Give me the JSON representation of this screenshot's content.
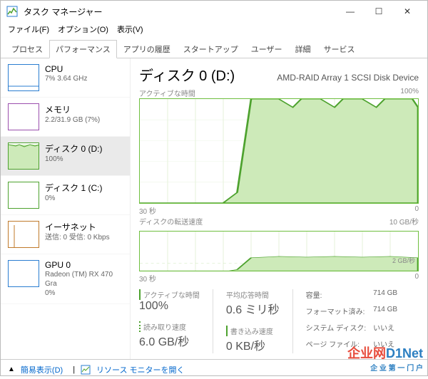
{
  "title": "タスク マネージャー",
  "menus": [
    "ファイル(F)",
    "オプション(O)",
    "表示(V)"
  ],
  "tabs": [
    "プロセス",
    "パフォーマンス",
    "アプリの履歴",
    "スタートアップ",
    "ユーザー",
    "詳細",
    "サービス"
  ],
  "active_tab": 1,
  "sidebar": [
    {
      "name": "CPU",
      "sub": "7%  3.64 GHz",
      "color": "#2a7dd1"
    },
    {
      "name": "メモリ",
      "sub": "2.2/31.9 GB (7%)",
      "color": "#9b4fad"
    },
    {
      "name": "ディスク 0 (D:)",
      "sub": "100%",
      "color": "#4da22e",
      "selected": true
    },
    {
      "name": "ディスク 1 (C:)",
      "sub": "0%",
      "color": "#4da22e"
    },
    {
      "name": "イーサネット",
      "sub": "送信: 0  受信: 0 Kbps",
      "color": "#c07a2a"
    },
    {
      "name": "GPU 0",
      "sub": "Radeon (TM) RX 470 Gra\n0%",
      "color": "#2a7dd1"
    }
  ],
  "main": {
    "title": "ディスク 0 (D:)",
    "subtitle": "AMD-RAID Array 1  SCSI Disk Device",
    "graph1": {
      "label": "アクティブな時間",
      "max": "100%",
      "xleft": "30 秒",
      "xright": "0"
    },
    "graph2": {
      "label": "ディスクの転送速度",
      "max": "10 GB/秒",
      "mid": "2 GB/秒",
      "xleft": "30 秒",
      "xright": "0"
    },
    "stats": {
      "active_time": {
        "label": "アクティブな時間",
        "value": "100%"
      },
      "avg_resp": {
        "label": "平均応答時間",
        "value": "0.6 ミリ秒"
      },
      "read_speed": {
        "label": "読み取り速度",
        "value": "6.0 GB/秒"
      },
      "write_speed": {
        "label": "書き込み速度",
        "value": "0 KB/秒"
      }
    },
    "meta": {
      "capacity_l": "容量:",
      "capacity_v": "714 GB",
      "formatted_l": "フォーマット済み:",
      "formatted_v": "714 GB",
      "sysdisk_l": "システム ディスク:",
      "sysdisk_v": "いいえ",
      "pagefile_l": "ページ ファイル:",
      "pagefile_v": "いいえ"
    }
  },
  "footer": {
    "fewer": "簡易表示(D)",
    "resmon": "リソース モニターを開く"
  },
  "chart_data": [
    {
      "type": "area",
      "title": "アクティブな時間",
      "ylabel": "%",
      "ylim": [
        0,
        100
      ],
      "xlim_label": [
        "30 秒",
        "0"
      ],
      "x": [
        0,
        10,
        20,
        30,
        35,
        40,
        45,
        50,
        55,
        60,
        65,
        70,
        75,
        80,
        85,
        90,
        95,
        100
      ],
      "values": [
        0,
        0,
        0,
        0,
        10,
        100,
        100,
        90,
        100,
        100,
        92,
        100,
        100,
        92,
        100,
        100,
        100,
        92
      ]
    },
    {
      "type": "area",
      "title": "ディスクの転送速度",
      "ylabel": "GB/秒",
      "ylim": [
        0,
        10
      ],
      "gridline": 2,
      "xlim_label": [
        "30 秒",
        "0"
      ],
      "x": [
        0,
        10,
        20,
        30,
        35,
        40,
        50,
        60,
        70,
        80,
        90,
        100
      ],
      "values": [
        0,
        0,
        0,
        0,
        0.2,
        3.4,
        3.6,
        3.5,
        3.6,
        3.5,
        3.6,
        3.4
      ]
    }
  ]
}
